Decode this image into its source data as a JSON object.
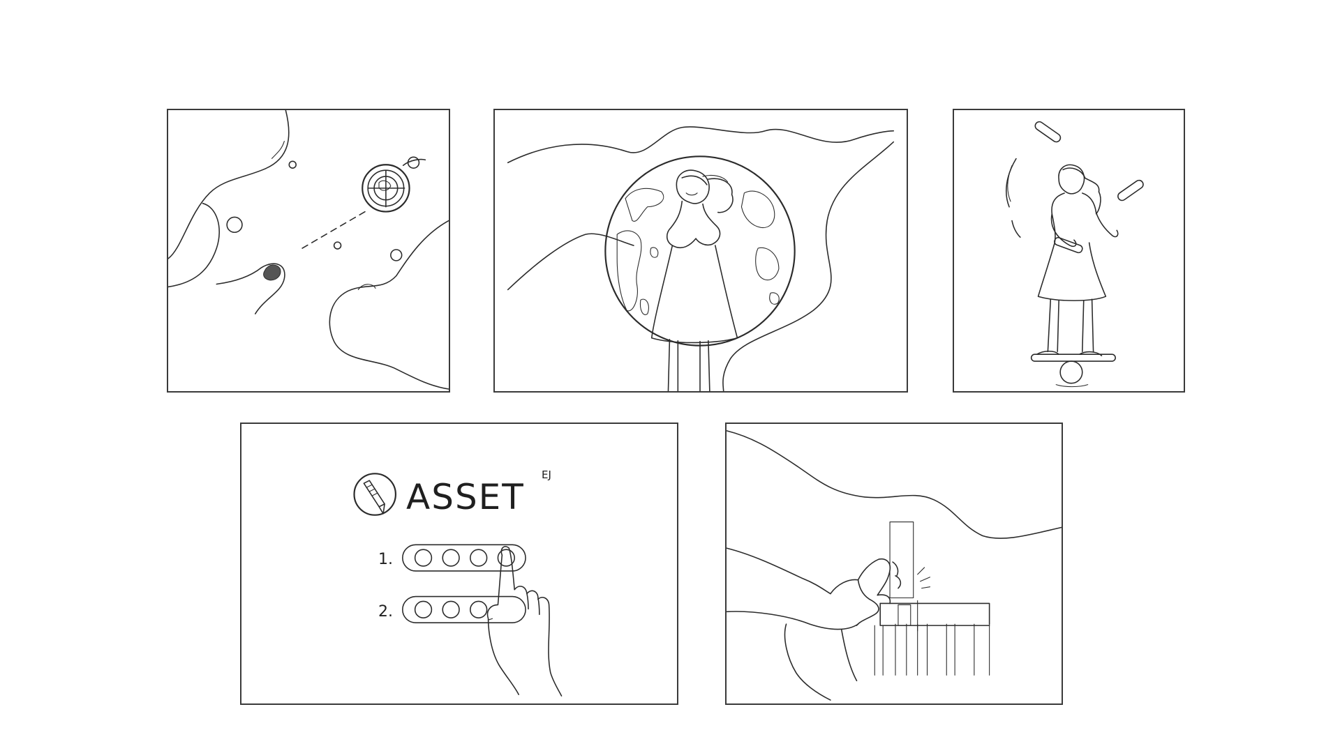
{
  "logo": {
    "word": "ASSET",
    "mark": "EJ",
    "icon": "pencil-circle-icon"
  },
  "steps": [
    {
      "number": "1."
    },
    {
      "number": "2."
    }
  ],
  "colors": {
    "background": "#ffffff",
    "stroke": "#2b2b2b"
  }
}
